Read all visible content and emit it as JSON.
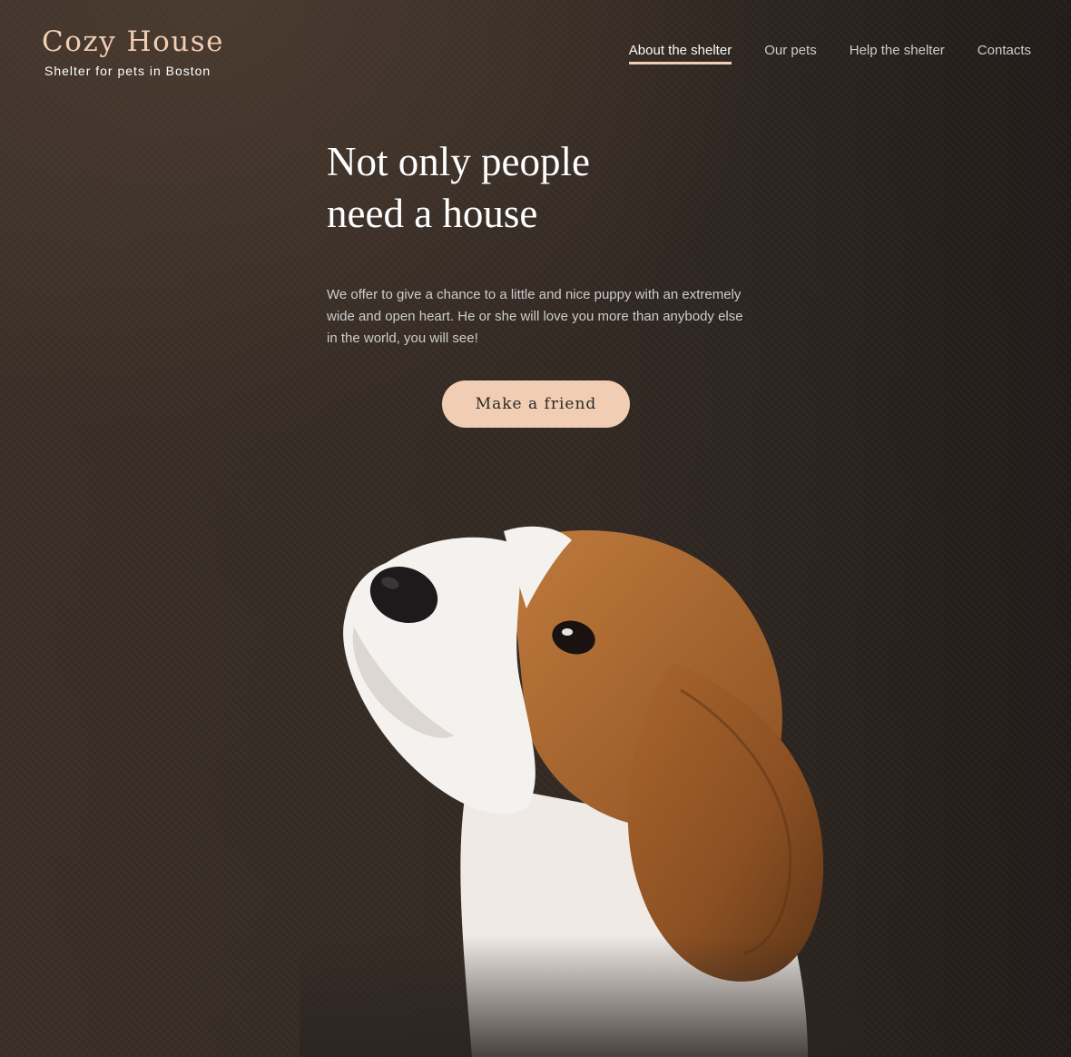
{
  "header": {
    "logo_title": "Cozy House",
    "logo_subtitle": "Shelter for pets in Boston",
    "nav": [
      {
        "label": "About the shelter",
        "active": true
      },
      {
        "label": "Our pets",
        "active": false
      },
      {
        "label": "Help the shelter",
        "active": false
      },
      {
        "label": "Contacts",
        "active": false
      }
    ]
  },
  "hero": {
    "title_line1": "Not only people",
    "title_line2": "need a house",
    "text": "We offer to give a chance to a little and nice puppy with an extremely wide and open heart. He or she will love you more than anybody else in the world, you will see!",
    "button_label": "Make a friend"
  },
  "colors": {
    "accent": "#f1cdb3",
    "background": "#332a24",
    "nav_text": "#cdcdcd",
    "heading": "#ffffff"
  }
}
